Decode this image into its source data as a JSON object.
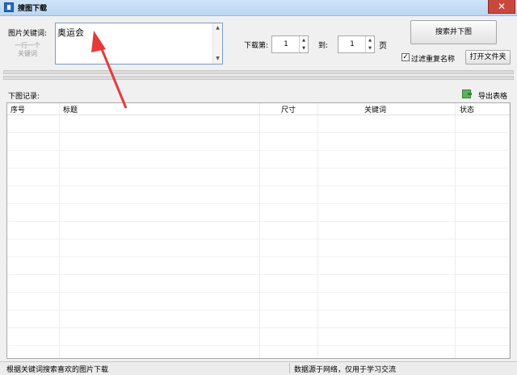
{
  "window": {
    "title": "搜图下载",
    "close_label": "✕"
  },
  "search": {
    "keyword_label": "图片关键词:",
    "keyword_value": "奥运会",
    "one_per_line_label": "一行一个\n关键词",
    "download_page_label": "下载第:",
    "start_page": "1",
    "to_label": "到:",
    "end_page": "1",
    "page_unit": "页",
    "search_button": "搜索并下图",
    "filter_duplicates_label": "过滤重复名称",
    "filter_duplicates_checked": true,
    "open_folder_button": "打开文件夹"
  },
  "records": {
    "label": "下图记录:",
    "export_label": "导出表格",
    "columns": [
      "序号",
      "标题",
      "尺寸",
      "关键词",
      "状态"
    ],
    "rows": []
  },
  "status": {
    "left": "根据关键词搜索喜欢的图片下载",
    "right": "数据源于网络，仅用于学习交流"
  },
  "colors": {
    "accent_arrow": "#e8393a",
    "title_bar": "#b9d6f2",
    "close_button": "#c9483e"
  }
}
